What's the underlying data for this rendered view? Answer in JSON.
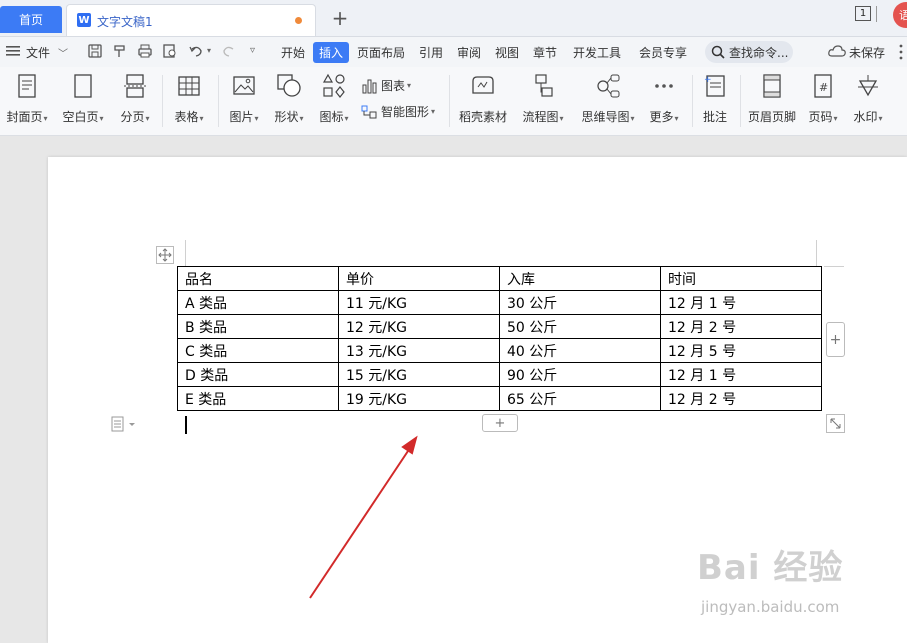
{
  "tabs": {
    "home_label": "首页",
    "doc_title": "文字文稿1",
    "doc_icon_letter": "W",
    "new_tab_symbol": "+",
    "window_count": "1",
    "avatar_text": "语"
  },
  "menu": {
    "file_label": "文件",
    "items": [
      "开始",
      "插入",
      "页面布局",
      "引用",
      "审阅",
      "视图",
      "章节",
      "开发工具",
      "会员专享"
    ],
    "active_item": "插入",
    "search_placeholder": "查找命令...",
    "unsaved_label": "未保存"
  },
  "ribbon": {
    "cover": "封面页",
    "blank": "空白页",
    "pagebreak": "分页",
    "table": "表格",
    "picture": "图片",
    "shape": "形状",
    "icon": "图标",
    "chart": "图表",
    "smartart": "智能图形",
    "material": "稻壳素材",
    "flowchart": "流程图",
    "mindmap": "思维导图",
    "more": "更多",
    "comment": "批注",
    "header_footer": "页眉页脚",
    "page_number": "页码",
    "watermark": "水印"
  },
  "table": {
    "rows": [
      [
        "品名",
        "单价",
        "入库",
        "时间"
      ],
      [
        "A 类品",
        "11 元/KG",
        "30 公斤",
        "12 月 1 号"
      ],
      [
        "B 类品",
        "12 元/KG",
        "50 公斤",
        "12 月 2 号"
      ],
      [
        "C 类品",
        "13 元/KG",
        "40 公斤",
        "12 月 5 号"
      ],
      [
        "D 类品",
        "15 元/KG",
        "90 公斤",
        "12 月 1 号"
      ],
      [
        "E 类品",
        "19 元/KG",
        "65 公斤",
        "12 月 2 号"
      ]
    ],
    "add_symbol": "+"
  },
  "watermark": {
    "logo": "Bai 经验",
    "site": "jingyan.baidu.com"
  },
  "colors": {
    "accent": "#3c7bf5",
    "annotation_arrow": "#d22a2a"
  }
}
